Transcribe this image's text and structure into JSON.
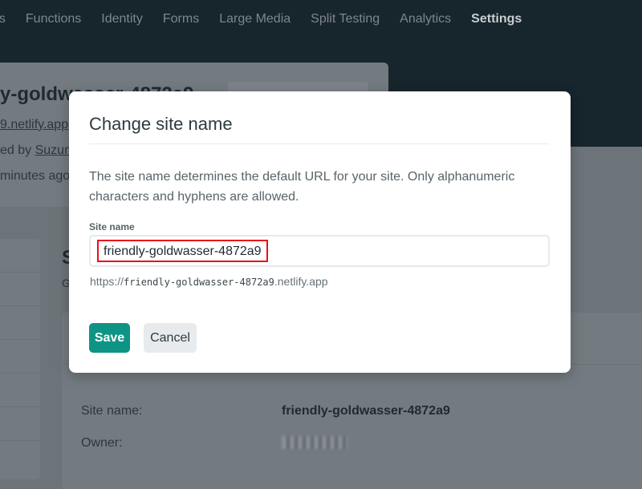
{
  "nav": {
    "items": [
      "ns",
      "Functions",
      "Identity",
      "Forms",
      "Large Media",
      "Split Testing",
      "Analytics",
      "Settings"
    ],
    "active": "Settings"
  },
  "header": {
    "title": "y-goldwasser-4872a9",
    "url": "9.netlify.app",
    "owned": "ed by ",
    "owner_link": "Suzum",
    "updated": "minutes ago)"
  },
  "section": {
    "title": "S",
    "subtitle": "G"
  },
  "details": {
    "site_name_label": "Site name:",
    "site_name_value": "friendly-goldwasser-4872a9",
    "owner_label": "Owner:"
  },
  "modal": {
    "title": "Change site name",
    "description": "The site name determines the default URL for your site. Only alphanumeric characters and hyphens are allowed.",
    "field_label": "Site name",
    "field_value": "friendly-goldwasser-4872a9",
    "url_prefix": "https://",
    "url_name": "friendly-goldwasser-4872a9",
    "url_suffix": ".netlify.app",
    "save_label": "Save",
    "cancel_label": "Cancel"
  },
  "colors": {
    "accent": "#0e9484",
    "highlight": "#e8101a"
  }
}
